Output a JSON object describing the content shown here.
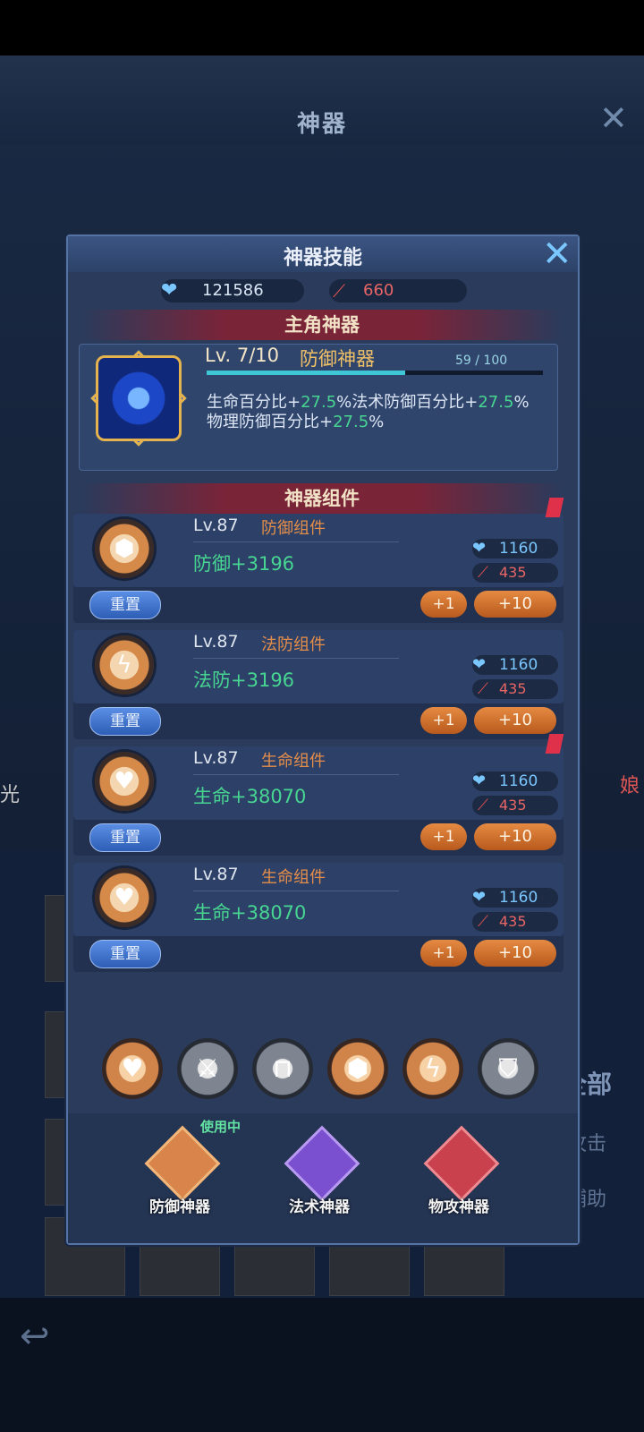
{
  "background": {
    "title": "神器",
    "side_left": "光",
    "side_right": "娘",
    "filter_all": "全部",
    "filter_attack": "攻击",
    "filter_support": "辅助"
  },
  "panel": {
    "title": "神器技能",
    "currency": [
      {
        "icon": "blue-heart-icon",
        "value": "121586"
      },
      {
        "icon": "red-feather-icon",
        "value": "660"
      }
    ],
    "main": {
      "banner": "主角神器",
      "level": "Lv. 7/10",
      "type": "防御神器",
      "progress_text": "59 / 100",
      "progress": 0.59,
      "stat1_a": "生命百分比+",
      "stat1_b": "27.5",
      "stat1_c": "%法术防御百分比+",
      "stat1_d": "27.5",
      "stat1_e": "%",
      "stat2_a": "物理防御百分比+",
      "stat2_b": "27.5",
      "stat2_c": "%"
    },
    "components_banner": "神器组件",
    "components": [
      {
        "level": "Lv.87",
        "name": "防御组件",
        "stat": "防御+3196",
        "cost_blue": "1160",
        "cost_red": "435",
        "icon": "shield-icon",
        "badge": true
      },
      {
        "level": "Lv.87",
        "name": "法防组件",
        "stat": "法防+3196",
        "cost_blue": "1160",
        "cost_red": "435",
        "icon": "lightning-shield-icon",
        "badge": false
      },
      {
        "level": "Lv.87",
        "name": "生命组件",
        "stat": "生命+38070",
        "cost_blue": "1160",
        "cost_red": "435",
        "icon": "heart-icon",
        "badge": true
      },
      {
        "level": "Lv.87",
        "name": "生命组件",
        "stat": "生命+38070",
        "cost_blue": "1160",
        "cost_red": "435",
        "icon": "heart-icon",
        "badge": false
      }
    ],
    "buttons": {
      "reset": "重置",
      "plus1": "+1",
      "plus10": "+10"
    },
    "skills": [
      "heart-icon",
      "axe-icon",
      "gate-icon",
      "shield-icon",
      "lightning-shield-icon",
      "shield-sword-icon"
    ],
    "tabs": [
      {
        "label": "防御神器",
        "color": "#d8844a"
      },
      {
        "label": "法术神器",
        "color": "#7a4fd0"
      },
      {
        "label": "物攻神器",
        "color": "#c8414c"
      }
    ],
    "in_use": "使用中"
  }
}
